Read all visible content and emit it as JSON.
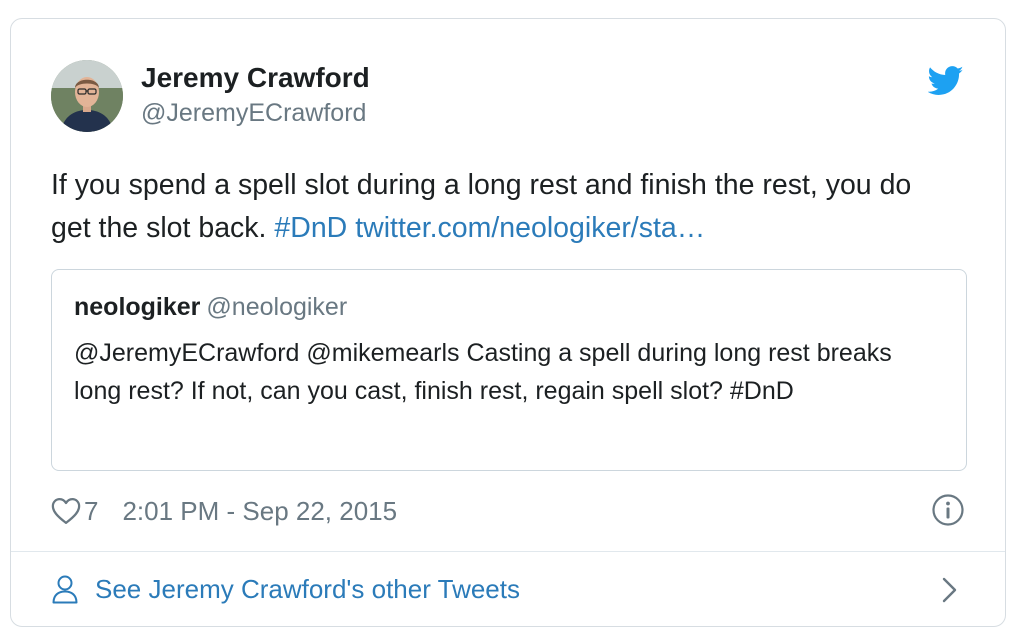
{
  "author": {
    "display_name": "Jeremy Crawford",
    "handle": "@JeremyECrawford"
  },
  "tweet": {
    "text": "If you spend a spell slot during a long rest and finish the rest, you do get the slot back.",
    "hashtag": "#DnD",
    "link": "twitter.com/neologiker/sta…"
  },
  "quoted_tweet": {
    "author_name": "neologiker",
    "author_handle": "@neologiker",
    "text": "@JeremyECrawford @mikemearls Casting a spell during long rest breaks long rest? If not, can you cast, finish rest, regain spell slot? #DnD"
  },
  "meta": {
    "like_count": "7",
    "timestamp": "2:01 PM - Sep 22, 2015"
  },
  "footer": {
    "link_text": "See Jeremy Crawford's other Tweets"
  },
  "icons": {
    "brand": "twitter-bird-icon",
    "like": "heart-icon",
    "info": "info-icon",
    "profile": "person-icon",
    "navigate": "chevron-right-icon"
  },
  "colors": {
    "link": "#2b7bb9",
    "twitter_blue": "#1da1f2",
    "secondary_text": "#697882",
    "primary_text": "#1c2022",
    "border": "#d7dde2"
  }
}
